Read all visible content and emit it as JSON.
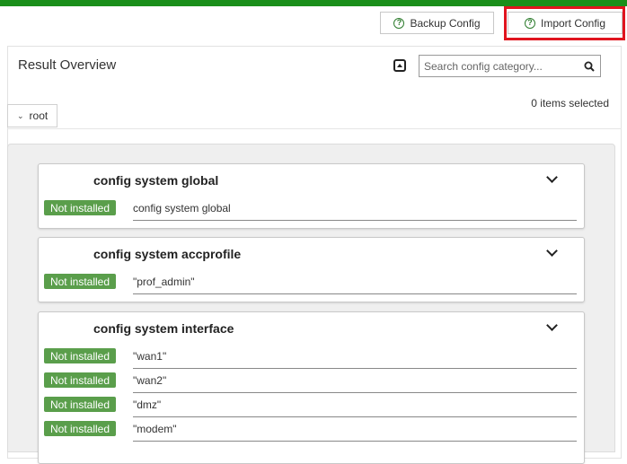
{
  "toolbar": {
    "backup_label": "Backup Config",
    "import_label": "Import Config"
  },
  "panel": {
    "title": "Result Overview",
    "search_placeholder": "Search config category...",
    "items_selected": "0 items selected",
    "breadcrumb": "root"
  },
  "status_label": "Not installed",
  "cards": [
    {
      "title": "config system global",
      "rows": [
        "config system global"
      ]
    },
    {
      "title": "config system accprofile",
      "rows": [
        "\"prof_admin\""
      ]
    },
    {
      "title": "config system interface",
      "rows": [
        "\"wan1\"",
        "\"wan2\"",
        "\"dmz\"",
        "\"modem\""
      ]
    }
  ],
  "colors": {
    "top_bar": "#1a8f1a",
    "badge": "#5a9e4b",
    "highlight": "#e0141e"
  },
  "icons": {
    "help": "help-circle-icon",
    "search": "search-icon",
    "collapse_all": "collapse-all-icon",
    "chevron": "chevron-down-icon"
  }
}
